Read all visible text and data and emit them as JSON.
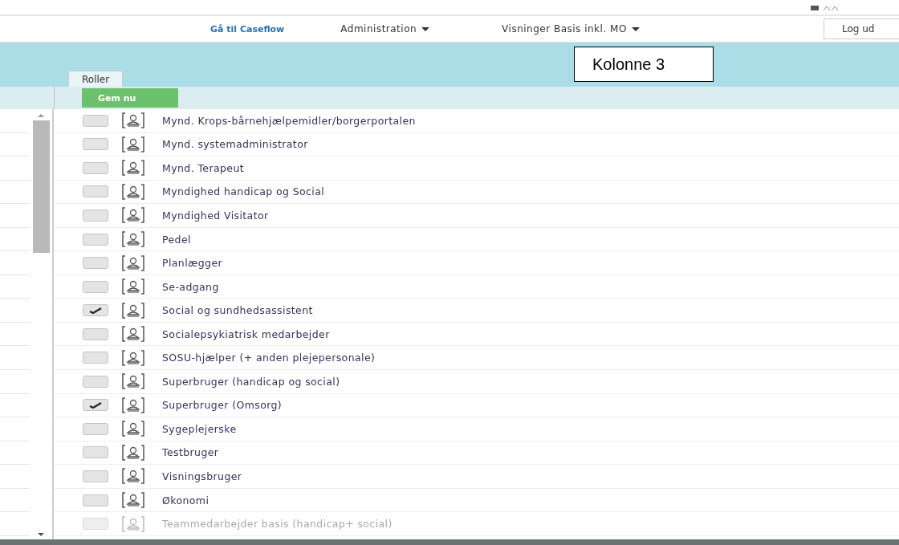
{
  "nav": {
    "caseflow_link": "Gå til Caseflow",
    "menus": [
      {
        "label": "Administration"
      },
      {
        "label": "Visninger Basis inkl. MO"
      }
    ],
    "logout": "Log ud"
  },
  "annotation": "Kolonne 3",
  "tabs": [
    {
      "label": "Roller",
      "selected": true
    }
  ],
  "save_button": "Gem nu",
  "roles": [
    {
      "label": "Mynd. Krops-bårnehjælpemidler/borgerportalen",
      "checked": false,
      "disabled": false
    },
    {
      "label": "Mynd. systemadministrator",
      "checked": false,
      "disabled": false
    },
    {
      "label": "Mynd. Terapeut",
      "checked": false,
      "disabled": false
    },
    {
      "label": "Myndighed handicap og Social",
      "checked": false,
      "disabled": false
    },
    {
      "label": "Myndighed Visitator",
      "checked": false,
      "disabled": false
    },
    {
      "label": "Pedel",
      "checked": false,
      "disabled": false
    },
    {
      "label": "Planlægger",
      "checked": false,
      "disabled": false
    },
    {
      "label": "Se-adgang",
      "checked": false,
      "disabled": false
    },
    {
      "label": "Social og sundhedsassistent",
      "checked": true,
      "disabled": false
    },
    {
      "label": "Socialepsykiatrisk medarbejder",
      "checked": false,
      "disabled": false
    },
    {
      "label": "SOSU-hjælper (+ anden plejepersonale)",
      "checked": false,
      "disabled": false
    },
    {
      "label": "Superbruger (handicap og social)",
      "checked": false,
      "disabled": false
    },
    {
      "label": "Superbruger (Omsorg)",
      "checked": true,
      "disabled": false
    },
    {
      "label": "Sygeplejerske",
      "checked": false,
      "disabled": false
    },
    {
      "label": "Testbruger",
      "checked": false,
      "disabled": false
    },
    {
      "label": "Visningsbruger",
      "checked": false,
      "disabled": false
    },
    {
      "label": "Økonomi",
      "checked": false,
      "disabled": false
    },
    {
      "label": "Teammedarbejder basis (handicap+ social)",
      "checked": false,
      "disabled": true
    }
  ]
}
